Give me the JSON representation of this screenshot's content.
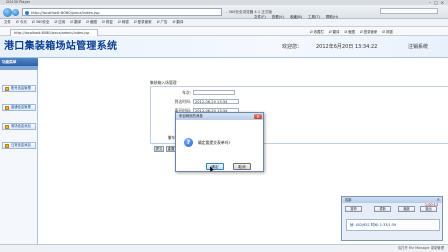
{
  "player": {
    "title": "i20130 Player"
  },
  "browser": {
    "url": "http://localhost:8080/jzxcz/index.jsp",
    "title": "- 360安全浏览器 4.1 正式版",
    "menu": [
      "文件(F)",
      "查看(V)",
      "收藏(B)",
      "工具(T)",
      "帮助(H)"
    ],
    "tab_label": "http://localhost:8080/jzxcz/admin/index.jsp",
    "toolbar": [
      "文件",
      "Ø 今天",
      "Ø 360安全",
      "Ø 应用",
      "Ø 翻译",
      "Ø 截图",
      "Ø 修复",
      "Ø 网银",
      "Ø 登录管家",
      "Ø 广告",
      "Ø 翻译"
    ],
    "fav_tools": [
      "Ø 收藏栏",
      "Ø 翻译",
      "Ø 截图",
      "Ø 登录管家",
      "Ø 网银"
    ]
  },
  "banner": {
    "brand": "港口集装箱场站管理系统",
    "welcome": "欢迎您：",
    "datetime": "2012年6月20日 13:34:22",
    "logout": "注销系统"
  },
  "sidebar": {
    "title": "功能菜单",
    "items": [
      "账号信息管理",
      "普通信息管理",
      "堆场信息添加",
      "日常信息添加"
    ]
  },
  "main": {
    "crumb": "集装箱入场管理",
    "fields": [
      {
        "label": "车次:",
        "value": ""
      },
      {
        "label": "到达时间:",
        "value": "2012-06-20 13:34"
      },
      {
        "label": "离开时间:",
        "value": "2012-06-20 13:34"
      },
      {
        "label": "货品类别:",
        "value": ""
      },
      {
        "label": "到达港口:",
        "value": ""
      },
      {
        "label": "撤车(列车)号:",
        "value": ""
      }
    ],
    "submit": "提交",
    "reset": "重置"
  },
  "dialog": {
    "title": "来自网页的消息",
    "message": "确定要提交表单吗?",
    "ok": "确定",
    "cancel": "取消"
  },
  "recorder": {
    "title": "控制",
    "buttons": [
      "暂停",
      "重新",
      "播放",
      "退出"
    ],
    "timer": "1:00:13",
    "line1": "帧: 452/652 时间: 1:33/1:59",
    "line2": ""
  },
  "status": {
    "text": "请打开 File Manager 录制管理"
  }
}
